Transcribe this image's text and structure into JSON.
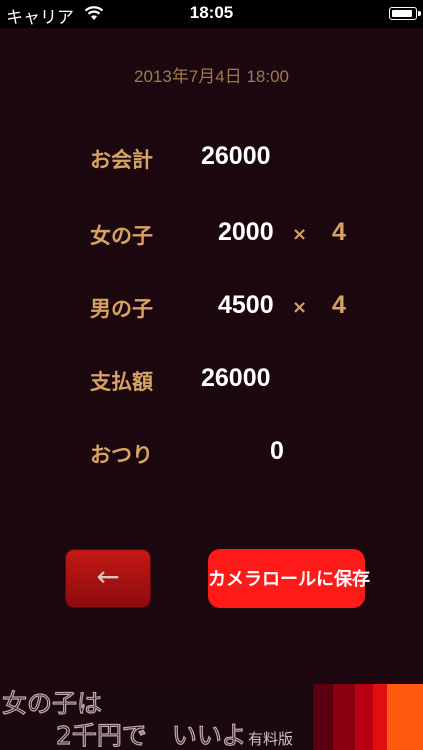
{
  "status_bar": {
    "carrier": "キャリア",
    "time": "18:05",
    "wifi_icon": "wifi-icon",
    "battery_icon": "battery-icon"
  },
  "datetime": "2013年7月4日 18:00",
  "rows": {
    "bill": {
      "label": "お会計",
      "value": "26000"
    },
    "girls": {
      "label": "女の子",
      "value": "2000",
      "times": "×",
      "count": "4"
    },
    "boys": {
      "label": "男の子",
      "value": "4500",
      "times": "×",
      "count": "4"
    },
    "paid": {
      "label": "支払額",
      "value": "26000"
    },
    "change": {
      "label": "おつり",
      "value": "0"
    }
  },
  "buttons": {
    "back": "←",
    "save": "カメラロールに保存"
  },
  "ad": {
    "line1": "女の子は",
    "line2": "2千円で　いいよ",
    "tag": "有料版"
  },
  "colors": {
    "background": "#1a0710",
    "label": "#d7a361",
    "value": "#ffffff",
    "save_button": "#ff1a1a",
    "back_button": "#b0141a"
  }
}
